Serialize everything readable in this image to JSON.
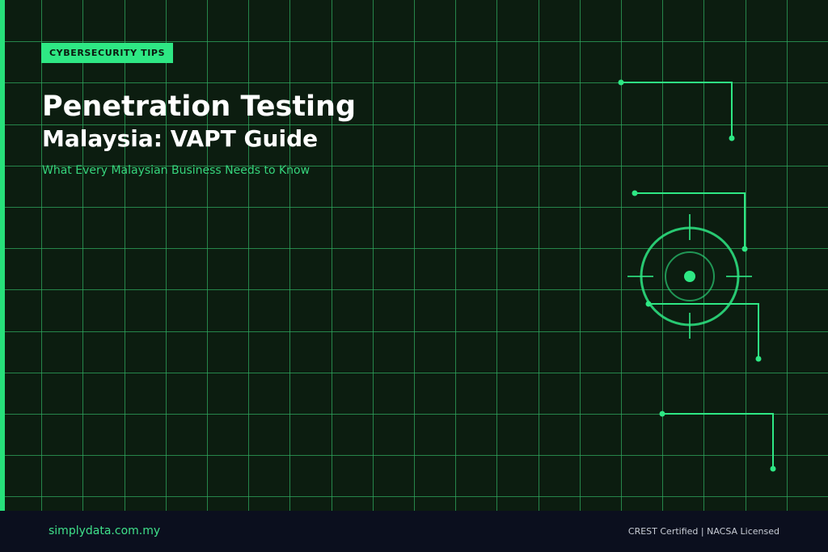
{
  "badge": {
    "label": "CYBERSECURITY TIPS"
  },
  "title": {
    "line1": "Penetration Testing",
    "line2": "Malaysia: VAPT Guide"
  },
  "subtitle": "What Every Malaysian Business Needs to Know",
  "footer": {
    "domain": "simplydata.com.my",
    "certifications": "CREST Certified | NACSA Licensed"
  },
  "icons": {
    "target": "crosshair-target-icon",
    "circuits": "circuit-trace-icon"
  },
  "colors": {
    "background": "#0c1d10",
    "grid": "#2fa85e",
    "accent": "#2ee884",
    "footer_bg": "#0b0f1e",
    "text_primary": "#ffffff",
    "text_accent": "#36d47c",
    "text_muted": "#c8cdd6"
  }
}
